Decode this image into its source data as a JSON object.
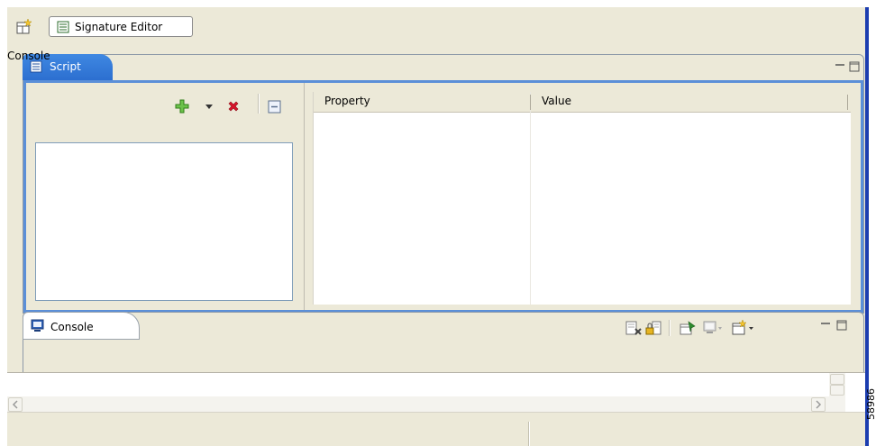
{
  "toolbar": {
    "open_perspective_icon": "open-perspective-icon",
    "editor_tab": {
      "label": "Signature Editor",
      "icon": "signature-editor-icon"
    }
  },
  "script_view": {
    "tab_label": "Script",
    "tab_icon": "script-icon",
    "toolbar": [
      {
        "name": "add-icon",
        "color": "#4caf2b"
      },
      {
        "name": "dropdown-arrow-icon"
      },
      {
        "name": "delete-icon",
        "color": "#d8152b"
      },
      {
        "name": "collapse-all-icon"
      }
    ],
    "table": {
      "columns": [
        "Property",
        "Value"
      ],
      "rows": []
    }
  },
  "console_view": {
    "tab_label": "Console",
    "tab_icon": "console-icon",
    "title": "Console",
    "toolbar": [
      "clear-console-icon",
      "scroll-lock-icon",
      "pin-console-icon",
      "display-selected-console-icon",
      "open-console-icon"
    ]
  },
  "figure_id": "58986",
  "colors": {
    "active_tab": "#3f88e2",
    "active_border": "#5b8fd8",
    "workbench_bg": "#ece9d8",
    "window_edge": "#1c3db0"
  }
}
